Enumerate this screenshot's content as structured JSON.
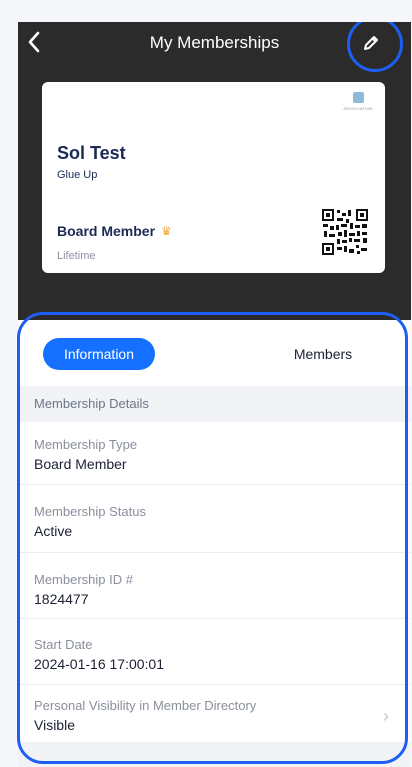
{
  "header": {
    "title": "My Memberships",
    "back_icon": "chevron-left-icon",
    "edit_icon": "pencil-icon"
  },
  "card": {
    "name": "Sol Test",
    "organization": "Glue Up",
    "tier": "Board Member",
    "duration": "Lifetime",
    "logo_text": "ASSOCIATION",
    "tier_icon": "crown-icon"
  },
  "tabs": [
    {
      "label": "Information",
      "active": true
    },
    {
      "label": "Members",
      "active": false
    }
  ],
  "section": {
    "title": "Membership Details"
  },
  "fields": [
    {
      "label": "Membership Type",
      "value": "Board Member"
    },
    {
      "label": "Membership Status",
      "value": "Active"
    },
    {
      "label": "Membership ID #",
      "value": "1824477"
    },
    {
      "label": "Start Date",
      "value": "2024-01-16  17:00:01"
    },
    {
      "label": "Personal Visibility in Member Directory",
      "value": "Visible"
    }
  ],
  "colors": {
    "header_bg": "#2b2b2b",
    "accent": "#1570ff",
    "highlight": "#1e5ef3",
    "crown": "#f2a93b",
    "card_text": "#1a2a55"
  }
}
